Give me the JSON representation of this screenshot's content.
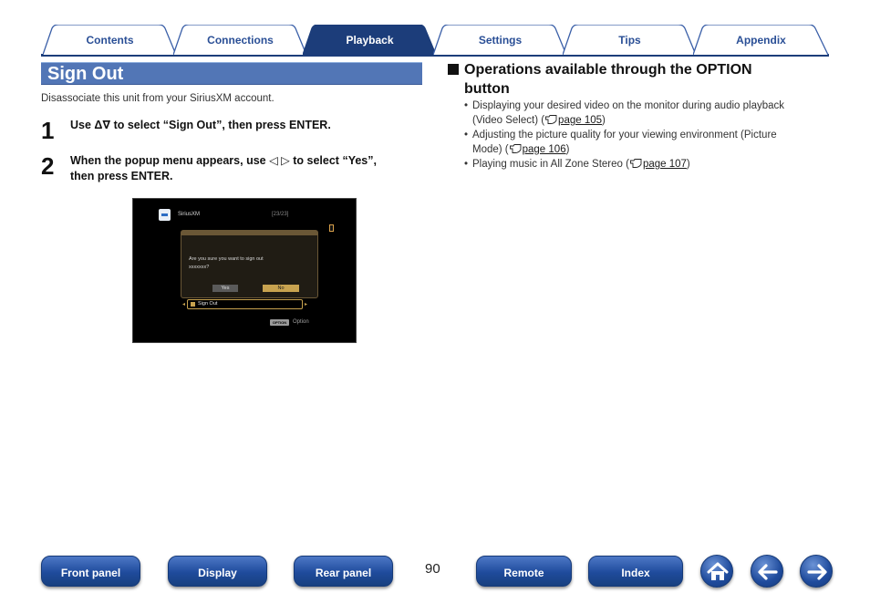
{
  "tabs": [
    {
      "label": "Contents",
      "active": false
    },
    {
      "label": "Connections",
      "active": false
    },
    {
      "label": "Playback",
      "active": true
    },
    {
      "label": "Settings",
      "active": false
    },
    {
      "label": "Tips",
      "active": false
    },
    {
      "label": "Appendix",
      "active": false
    }
  ],
  "colors": {
    "accent": "#1c3d7a",
    "section_bar": "#5276b6",
    "button": "#1f4b9c",
    "highlight": "#c7a24f"
  },
  "section": {
    "title": "Sign Out",
    "description": "Disassociate this unit from your SiriusXM account."
  },
  "steps": [
    {
      "number": "1",
      "text": "Use Δ∇ to select “Sign Out”, then press ENTER."
    },
    {
      "number": "2",
      "line1": "When the popup menu appears, use ◁ ▷ to select “Yes”,",
      "line2": "then press ENTER."
    }
  ],
  "screen": {
    "source": "SiriusXM",
    "count": "[23/23]",
    "dialog_line1": "Are you sure you want to sign out",
    "dialog_line2": "xxxxxxx?",
    "yes": "Yes",
    "no": "No",
    "menu_item": "Sign Out",
    "option_key": "OPTION",
    "option_label": "Option"
  },
  "options": {
    "heading_line1": "Operations available through the OPTION",
    "heading_line2": "button",
    "items": [
      {
        "text_line1": "Displaying your desired video on the monitor during audio playback",
        "text_line2": "(Video Select) (",
        "link": "page 105",
        "tail": ")"
      },
      {
        "text_line1": "Adjusting the picture quality for your viewing environment (Picture",
        "text_line2": "Mode) (",
        "link": "page 106",
        "tail": ")"
      },
      {
        "text_line1": "Playing music in All Zone Stereo (",
        "link": "page 107",
        "tail": ")"
      }
    ]
  },
  "page_number": "90",
  "bottom_nav": {
    "front_panel": "Front panel",
    "display": "Display",
    "rear_panel": "Rear panel",
    "remote": "Remote",
    "index": "Index",
    "home_icon": "home-icon",
    "back_icon": "arrow-left-icon",
    "forward_icon": "arrow-right-icon"
  }
}
